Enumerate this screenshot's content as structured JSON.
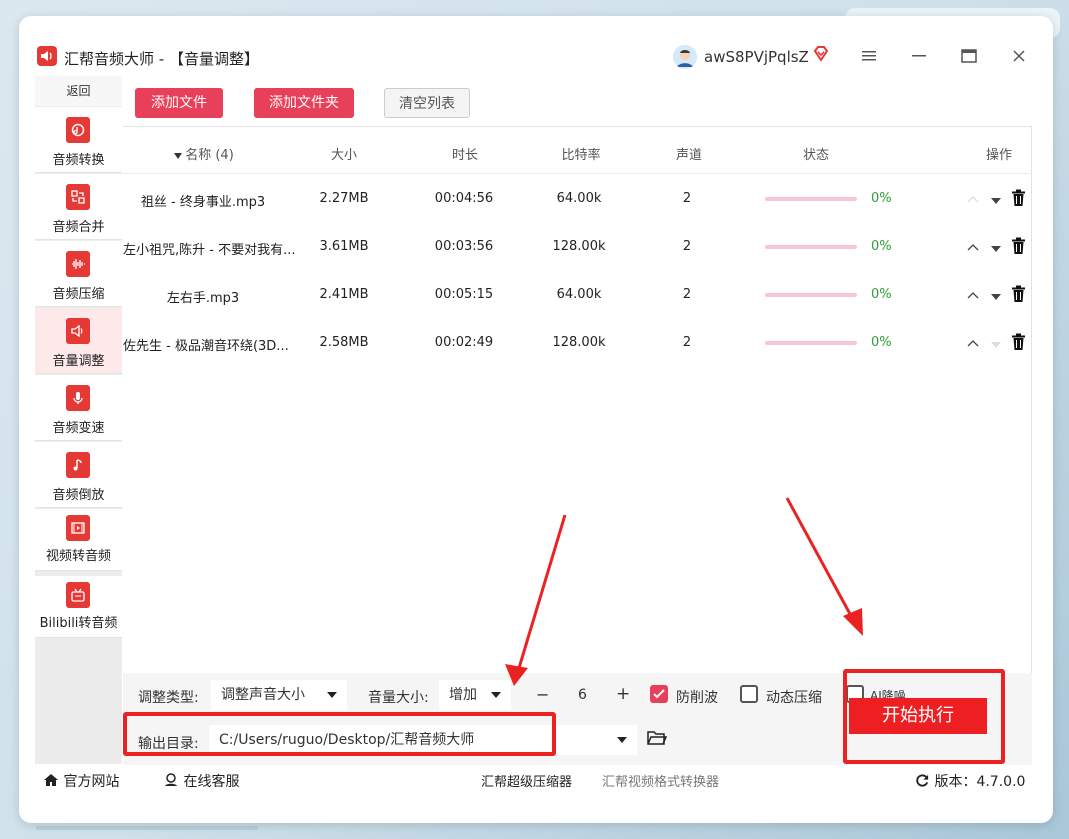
{
  "app": {
    "title": "汇帮音频大师  - 【音量调整】",
    "username": "awS8PVjPqlsZ"
  },
  "colors": {
    "accent": "#e8405a",
    "sidebar_icon": "#e53935",
    "progress_text": "#2e9e3a",
    "annotation": "#ea2322"
  },
  "sidebar": {
    "back_label": "返回",
    "items": [
      {
        "label": "音频转换",
        "icon": "audio-convert-icon"
      },
      {
        "label": "音频合并",
        "icon": "audio-merge-icon"
      },
      {
        "label": "音频压缩",
        "icon": "audio-compress-icon"
      },
      {
        "label": "音量调整",
        "icon": "volume-icon",
        "active": true
      },
      {
        "label": "音频变速",
        "icon": "microphone-icon"
      },
      {
        "label": "音频倒放",
        "icon": "music-note-icon"
      },
      {
        "label": "视频转音频",
        "icon": "film-icon"
      },
      {
        "label": "Bilibili转音频",
        "icon": "bilibili-tv-icon"
      }
    ]
  },
  "toolbar": {
    "add_file": "添加文件",
    "add_folder": "添加文件夹",
    "clear_list": "清空列表"
  },
  "table": {
    "headers": {
      "name": "名称 (4)",
      "size": "大小",
      "duration": "时长",
      "bitrate": "比特率",
      "channels": "声道",
      "status": "状态",
      "actions": "操作"
    },
    "rows": [
      {
        "name": "祖丝 - 终身事业.mp3",
        "size": "2.27MB",
        "duration": "00:04:56",
        "bitrate": "64.00k",
        "channels": "2",
        "progress": "0%"
      },
      {
        "name": "左小祖咒,陈升 - 不要对我有...",
        "size": "3.61MB",
        "duration": "00:03:56",
        "bitrate": "128.00k",
        "channels": "2",
        "progress": "0%"
      },
      {
        "name": "左右手.mp3",
        "size": "2.41MB",
        "duration": "00:05:15",
        "bitrate": "64.00k",
        "channels": "2",
        "progress": "0%"
      },
      {
        "name": "佐先生 - 极品潮音环绕(3D...",
        "size": "2.58MB",
        "duration": "00:02:49",
        "bitrate": "128.00k",
        "channels": "2",
        "progress": "0%"
      }
    ]
  },
  "settings": {
    "adjust_type_label": "调整类型:",
    "adjust_type_value": "调整声音大小",
    "volume_label": "音量大小:",
    "volume_mode": "增加",
    "volume_value": "6",
    "minus": "−",
    "plus": "+",
    "anti_clip_label": "防削波",
    "anti_clip_checked": true,
    "dynamic_compress_label": "动态压缩",
    "dynamic_compress_checked": false,
    "ai_denoise_label": "AI降噪",
    "output_label": "输出目录:",
    "output_path": "C:/Users/ruguo/Desktop/汇帮音频大师",
    "start_button": "开始执行"
  },
  "statusbar": {
    "official_site": "官方网站",
    "online_service": "在线客服",
    "link1": "汇帮超级压缩器",
    "link2": "汇帮视频格式转换器",
    "version": "版本：4.7.0.0"
  }
}
